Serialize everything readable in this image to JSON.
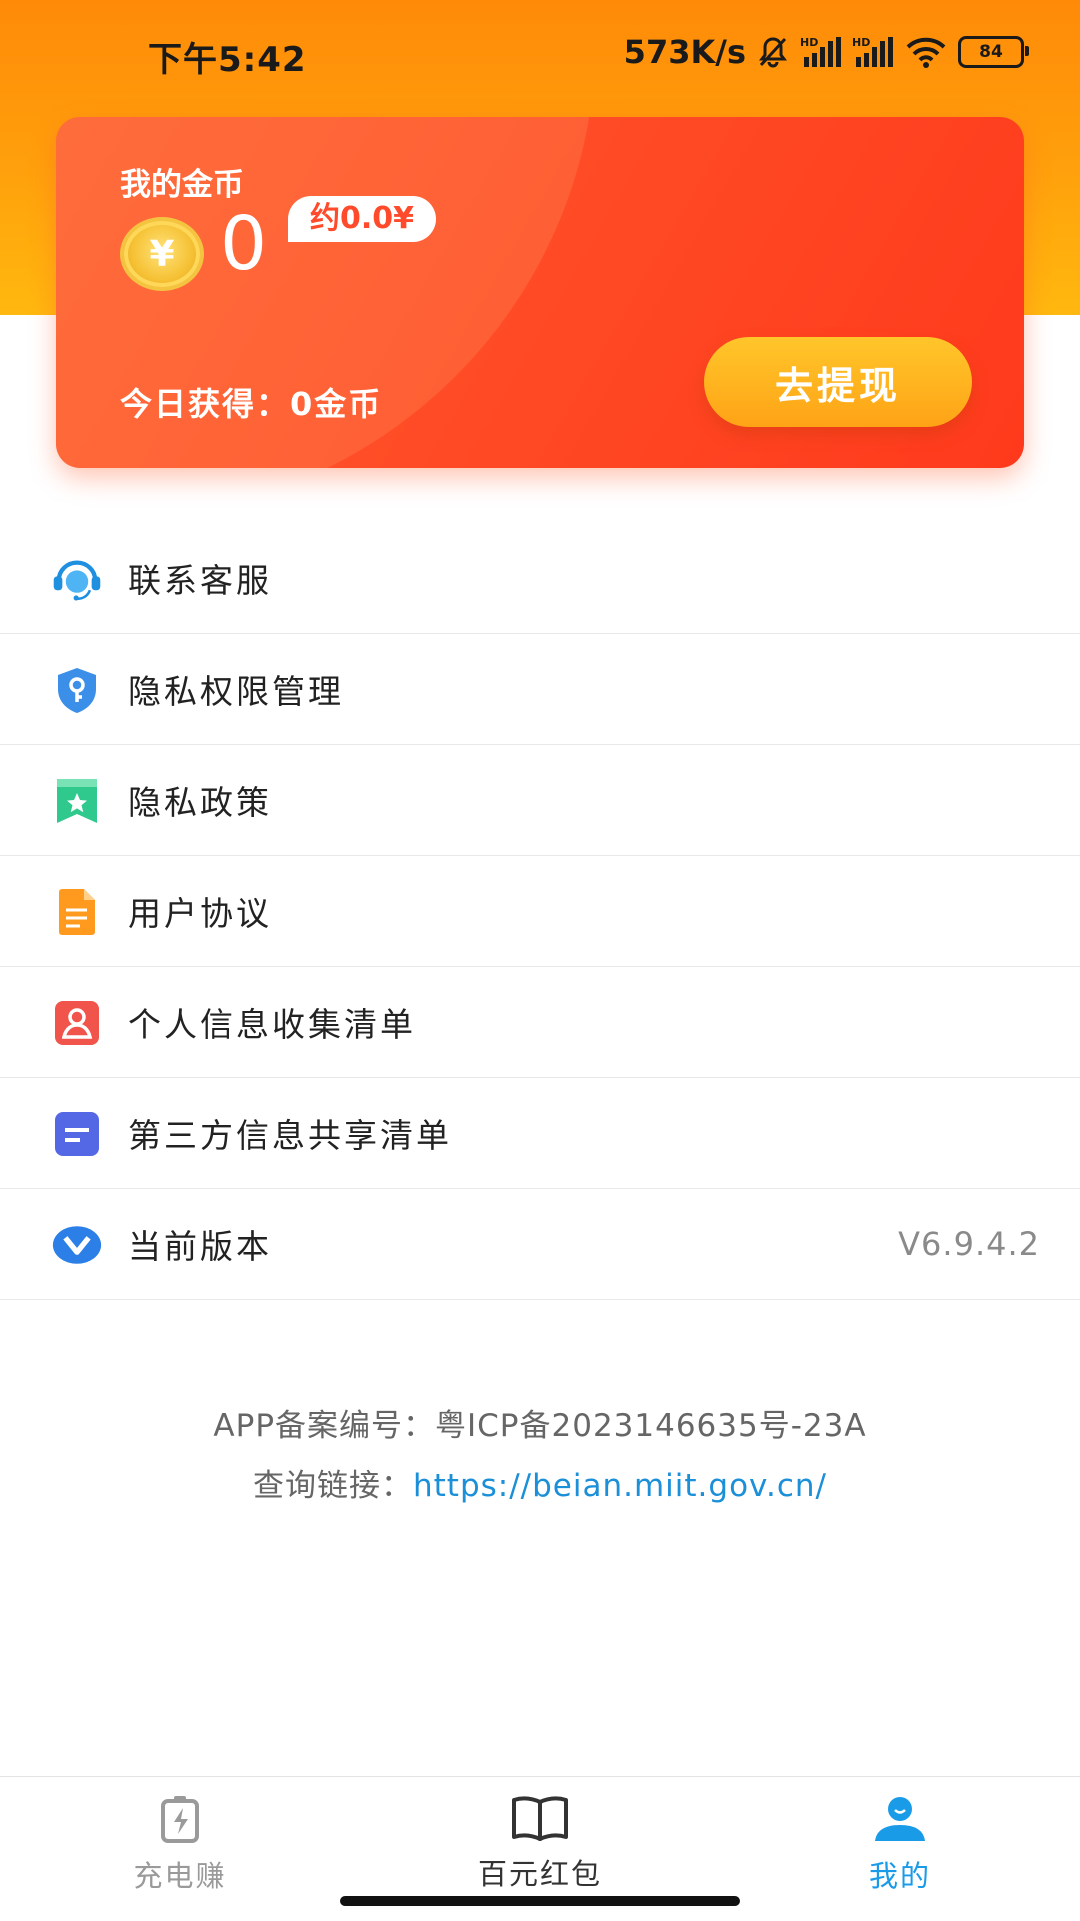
{
  "status_bar": {
    "time": "下午5:42",
    "net_speed": "573K/s",
    "battery": "84",
    "icons": [
      "mute-bell-icon",
      "signal-hd-icon",
      "signal-hd-icon",
      "wifi-icon",
      "battery-icon"
    ]
  },
  "coin_card": {
    "title": "我的金币",
    "coin_symbol": "¥",
    "coin_count": "0",
    "approx_value": "约0.0¥",
    "today_label": "今日获得：0金币",
    "withdraw_button": "去提现"
  },
  "menu": {
    "items": [
      {
        "label": "联系客服",
        "icon": "customer-service-icon"
      },
      {
        "label": "隐私权限管理",
        "icon": "shield-key-icon"
      },
      {
        "label": "隐私政策",
        "icon": "bookmark-star-icon"
      },
      {
        "label": "用户协议",
        "icon": "document-icon"
      },
      {
        "label": "个人信息收集清单",
        "icon": "person-card-icon"
      },
      {
        "label": "第三方信息共享清单",
        "icon": "list-card-icon"
      },
      {
        "label": "当前版本",
        "icon": "version-v-icon",
        "value": "V6.9.4.2"
      }
    ]
  },
  "footer": {
    "icp_text": "APP备案编号：粤ICP备2023146635号-23A",
    "query_label": "查询链接：",
    "query_url": "https://beian.miit.gov.cn/"
  },
  "tab_bar": {
    "tabs": [
      {
        "label": "充电赚",
        "icon": "battery-charge-icon",
        "active": false
      },
      {
        "label": "百元红包",
        "icon": "open-book-icon",
        "active": false
      },
      {
        "label": "我的",
        "icon": "user-profile-icon",
        "active": true
      }
    ],
    "active_color": "#1a9be8",
    "inactive_color": "#9a9a9a"
  },
  "colors": {
    "header_orange": "#ff8a08",
    "card_red": "#ff4a25",
    "withdraw_yellow": "#ffb21f"
  }
}
